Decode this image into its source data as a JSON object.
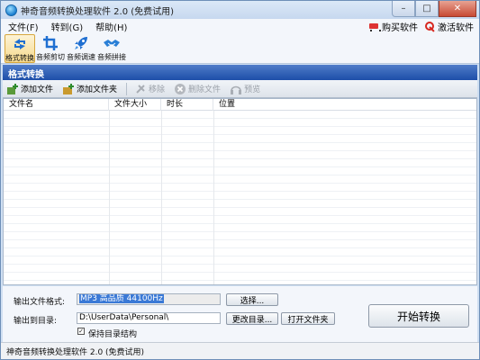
{
  "window": {
    "title": "神奇音频转换处理软件 2.0 (免费试用)"
  },
  "menu": {
    "items": [
      "文件(F)",
      "转到(G)",
      "帮助(H)"
    ],
    "buy": "购买软件",
    "activate": "激活软件"
  },
  "tools": [
    {
      "label": "格式转换",
      "icon": "format-convert-icon",
      "selected": true
    },
    {
      "label": "音频剪切",
      "icon": "crop-icon",
      "selected": false
    },
    {
      "label": "音频调速",
      "icon": "rocket-icon",
      "selected": false
    },
    {
      "label": "音频拼接",
      "icon": "handshake-icon",
      "selected": false
    }
  ],
  "section": {
    "title": "格式转换"
  },
  "actions": {
    "add_file": "添加文件",
    "add_folder": "添加文件夹",
    "remove": "移除",
    "delete_files": "删除文件",
    "preview": "预览"
  },
  "list": {
    "columns": [
      "文件名",
      "文件大小",
      "时长",
      "位置"
    ],
    "rows": []
  },
  "output": {
    "format_label": "输出文件格式:",
    "format_value": "MP3 高品质 44100Hz",
    "choose_button": "选择...",
    "dir_label": "输出到目录:",
    "dir_value": "D:\\UserData\\Personal\\",
    "change_dir_button": "更改目录...",
    "open_folder_button": "打开文件夹",
    "keep_structure_label": "保持目录结构",
    "keep_structure_checked": true,
    "start_button": "开始转换"
  },
  "status": {
    "text": "神奇音频转换处理软件 2.0 (免费试用)"
  }
}
